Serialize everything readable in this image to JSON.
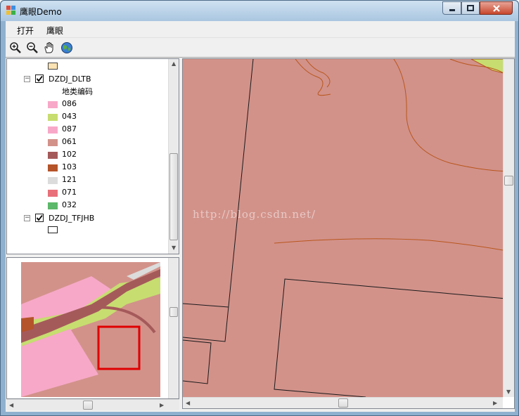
{
  "window": {
    "title": "鹰眼Demo",
    "min_label": "minimize",
    "max_label": "maximize",
    "close_label": "close"
  },
  "menu": [
    "打开",
    "鹰眼"
  ],
  "toolbar": {
    "tools": [
      "zoom-in-icon",
      "zoom-out-icon",
      "pan-hand-icon",
      "full-extent-globe-icon"
    ]
  },
  "toc": {
    "layers": [
      {
        "name": "DZDJ_DLTB",
        "checked": true,
        "expanded": true,
        "field": "地类编码",
        "classes": [
          {
            "code": "086",
            "color": "#f7a8c8"
          },
          {
            "code": "043",
            "color": "#c7dd70"
          },
          {
            "code": "087",
            "color": "#f7a8c8"
          },
          {
            "code": "061",
            "color": "#d2928a"
          },
          {
            "code": "102",
            "color": "#a55a5a"
          },
          {
            "code": "103",
            "color": "#b5542a"
          },
          {
            "code": "121",
            "color": "#dcdcdc"
          },
          {
            "code": "071",
            "color": "#e8707a"
          },
          {
            "code": "032",
            "color": "#5cb86a"
          }
        ]
      },
      {
        "name": "DZDJ_TFJHB",
        "checked": true,
        "expanded": true,
        "classes": [
          {
            "code": "",
            "color": "#ffffff"
          }
        ]
      }
    ],
    "top_swatch_color": "#fbe3b4"
  },
  "map": {
    "background_color": "#d2928a",
    "line_color": "#1a1a1a",
    "contour_color": "#b9561c",
    "watermark": "http://blog.csdn.net/"
  },
  "overview": {
    "extent_box_color": "#e00000"
  }
}
